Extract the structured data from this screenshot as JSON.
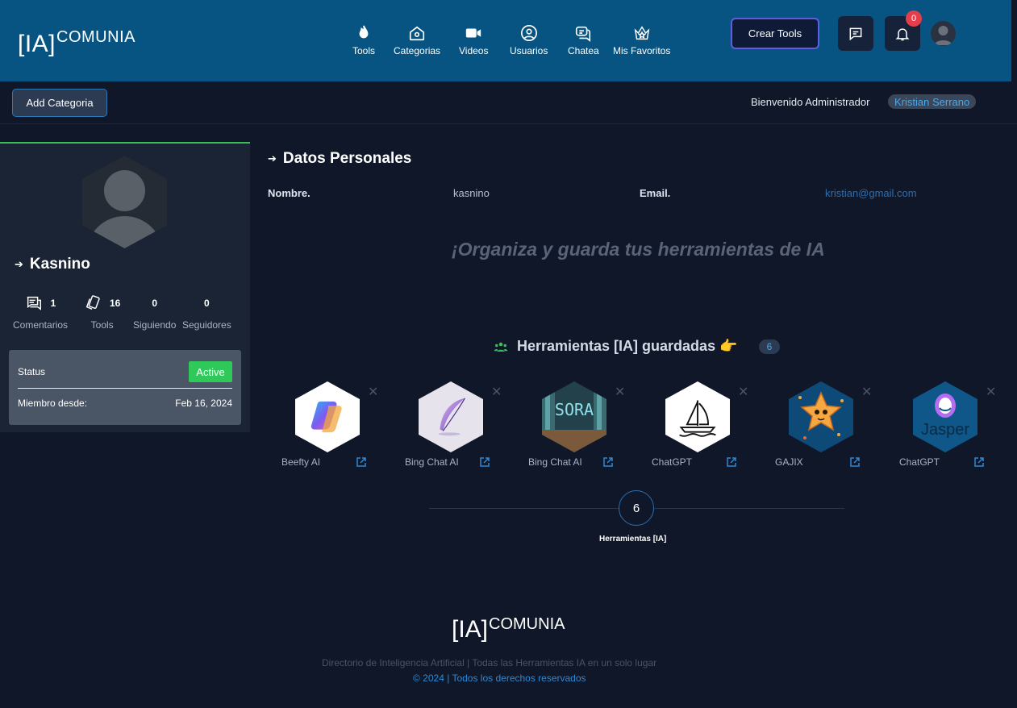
{
  "header": {
    "logo_bracket": "[IA]",
    "logo_brand": "COMUNIA",
    "nav": [
      {
        "label": "Tools",
        "icon": "flame-icon"
      },
      {
        "label": "Categorias",
        "icon": "home-icon"
      },
      {
        "label": "Videos",
        "icon": "video-camera-icon"
      },
      {
        "label": "Usuarios",
        "icon": "user-circle-icon"
      },
      {
        "label": "Chatea",
        "icon": "chat-bubbles-icon"
      },
      {
        "label": "Mis Favoritos",
        "icon": "crown-icon"
      }
    ],
    "create_button": "Crear Tools",
    "notification_count": "0"
  },
  "subbar": {
    "add_category": "Add Categoria",
    "welcome": "Bienvenido Administrador",
    "user_name": "Kristian Serrano"
  },
  "profile": {
    "name": "Kasnino",
    "stats": [
      {
        "value": "1",
        "label": "Comentarios",
        "icon": "comments-icon"
      },
      {
        "value": "16",
        "label": "Tools",
        "icon": "cards-icon"
      },
      {
        "value": "0",
        "label": "Siguiendo"
      },
      {
        "value": "0",
        "label": "Seguidores"
      }
    ],
    "status_label": "Status",
    "status_value": "Active",
    "member_label": "Miembro desde:",
    "member_date": "Feb 16, 2024"
  },
  "personal": {
    "title": "Datos Personales",
    "name_label": "Nombre.",
    "name_value": "kasnino",
    "email_label": "Email.",
    "email_value": "kristian@gmail.com"
  },
  "promo": {
    "headline": "¡Organiza y guarda tus herramientas de IA"
  },
  "saved": {
    "title": "Herramientas [IA] guardadas 👉",
    "count": "6",
    "tools": [
      {
        "name": "Beefty AI"
      },
      {
        "name": "Bing Chat AI"
      },
      {
        "name": "Bing Chat AI"
      },
      {
        "name": "ChatGPT"
      },
      {
        "name": "GAJIX"
      },
      {
        "name": "ChatGPT",
        "logo_text": "Jasper"
      }
    ]
  },
  "timeline": {
    "count": "6",
    "label": "Herramientas [IA]"
  },
  "footer": {
    "logo_bracket": "[IA]",
    "logo_brand": "COMUNIA",
    "description": "Directorio de Inteligencia Artificial | Todas las Herramientas IA en un solo lugar",
    "copyright": "© 2024 | Todos los derechos reservados"
  },
  "colors": {
    "header_bg": "#075482",
    "page_bg": "#0f1729",
    "accent_green": "#2fc95a",
    "accent_blue": "#4aa8ec"
  }
}
